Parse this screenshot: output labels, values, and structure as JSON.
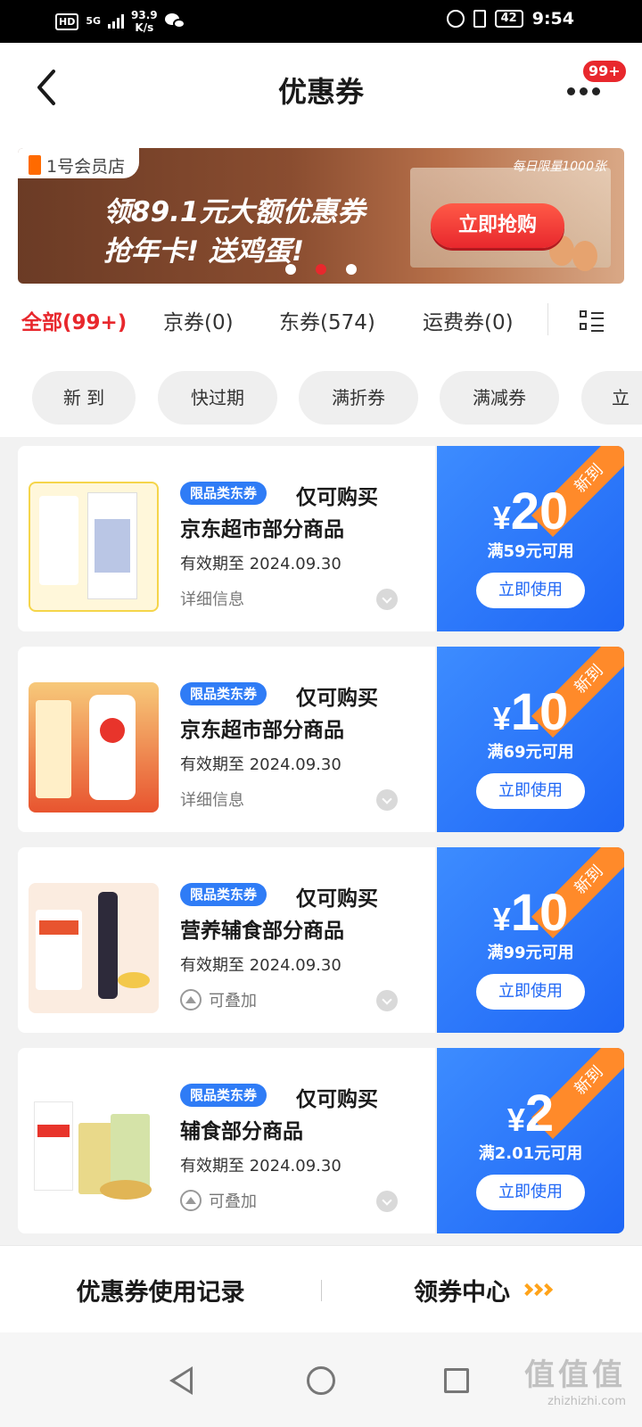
{
  "status_bar": {
    "hd": "HD",
    "signal": "5G",
    "speed_value": "93.9",
    "speed_unit": "K/s",
    "battery": "42",
    "time": "9:54"
  },
  "header": {
    "title": "优惠券",
    "badge": "99+"
  },
  "banner": {
    "logo": "1号会员店",
    "line1": "领89.1元大额优惠券",
    "line2": "抢年卡! 送鸡蛋!",
    "tag": "每日限量1000张",
    "button": "立即抢购",
    "active_dot": 1,
    "dot_count": 3
  },
  "tabs": [
    {
      "label": "全部(99+)",
      "active": true
    },
    {
      "label": "京券(0)",
      "active": false
    },
    {
      "label": "东券(574)",
      "active": false
    },
    {
      "label": "运费券(0)",
      "active": false
    }
  ],
  "filters": [
    "新 到",
    "快过期",
    "满折券",
    "满减券",
    "立"
  ],
  "coupons": [
    {
      "tag": "限品类东券",
      "line1": "仅可购买",
      "line2": "京东超市部分商品",
      "expiry": "有效期至 2024.09.30",
      "info": "详细信息",
      "info_icon": "",
      "amount": "20",
      "condition": "满59元可用",
      "button": "立即使用",
      "ribbon": "新到"
    },
    {
      "tag": "限品类东券",
      "line1": "仅可购买",
      "line2": "京东超市部分商品",
      "expiry": "有效期至 2024.09.30",
      "info": "详细信息",
      "info_icon": "",
      "amount": "10",
      "condition": "满69元可用",
      "button": "立即使用",
      "ribbon": "新到"
    },
    {
      "tag": "限品类东券",
      "line1": "仅可购买",
      "line2": "营养辅食部分商品",
      "expiry": "有效期至 2024.09.30",
      "info": "可叠加",
      "info_icon": "stack-icon",
      "amount": "10",
      "condition": "满99元可用",
      "button": "立即使用",
      "ribbon": "新到"
    },
    {
      "tag": "限品类东券",
      "line1": "仅可购买",
      "line2": "辅食部分商品",
      "expiry": "有效期至 2024.09.30",
      "info": "可叠加",
      "info_icon": "stack-icon",
      "amount": "2",
      "condition": "满2.01元可用",
      "button": "立即使用",
      "ribbon": "新到"
    }
  ],
  "currency": "¥",
  "bottom_bar": {
    "record": "优惠券使用记录",
    "center": "领券中心"
  },
  "watermark": {
    "text": "值值值",
    "url": "zhizhizhi.com"
  },
  "colors": {
    "accent_red": "#e8282d",
    "coupon_blue": "#1e66f5",
    "ribbon_orange": "#ff8a2a",
    "arrow_orange": "#ffa31a"
  }
}
